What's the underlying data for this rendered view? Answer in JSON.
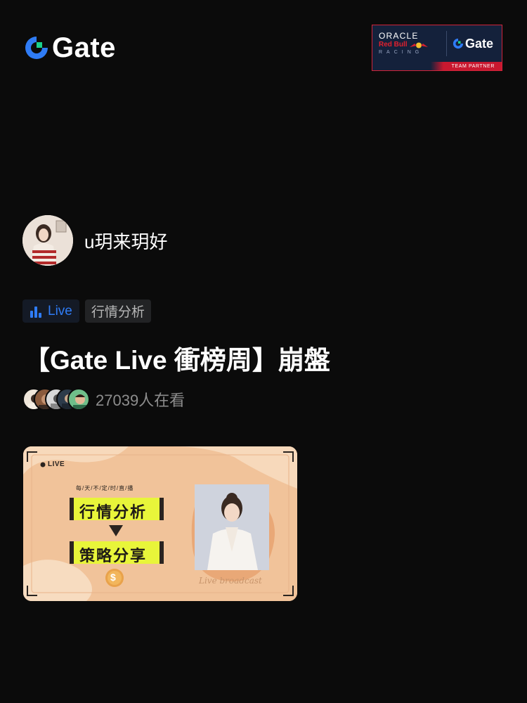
{
  "header": {
    "logo_text": "Gate",
    "partner": {
      "oracle": "ORACLE",
      "redbull": "Red Bull",
      "racing": "RACING",
      "gate": "Gate",
      "team_partner": "TEAM PARTNER"
    }
  },
  "host": {
    "name": "u玥来玥好",
    "avatar_icon": "host-avatar"
  },
  "tags": {
    "live": "Live",
    "category": "行情分析"
  },
  "title": "【Gate Live 衝榜周】崩盤",
  "viewers": {
    "count_text": "27039人在看",
    "avatar_count": 5
  },
  "banner": {
    "live_label": "LIVE",
    "schedule": "每/天/不/定/时/直/播",
    "line1": "行情分析",
    "line2": "策略分享",
    "signature": "Live broadcast"
  },
  "colors": {
    "background": "#0b0b0b",
    "accent_blue": "#2f7cf6",
    "gate_green": "#1ad18c",
    "banner_bg": "#f3c7a0",
    "highlight_yellow": "#e8f53a"
  }
}
